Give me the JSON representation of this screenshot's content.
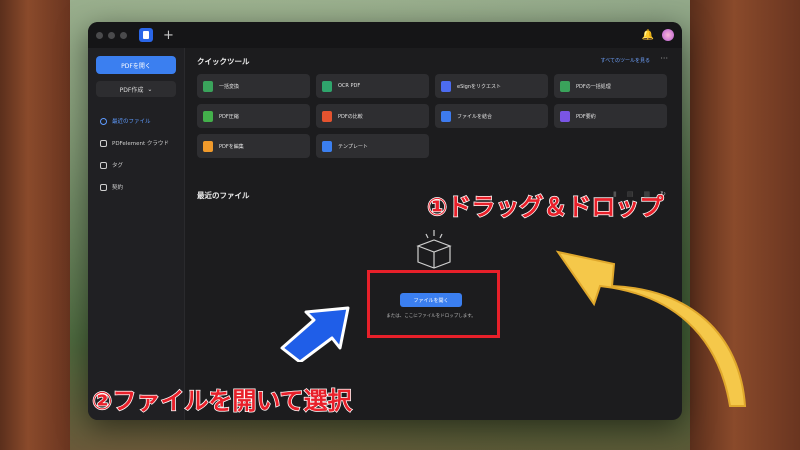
{
  "window": {
    "tab_plus": "+",
    "bell": "🔔"
  },
  "sidebar": {
    "open_pdf": "PDFを開く",
    "create_pdf": "PDF作成",
    "items": [
      {
        "label": "最近のファイル",
        "icon": "clock-icon",
        "active": true
      },
      {
        "label": "PDFelement クラウド",
        "icon": "cloud-icon",
        "active": false
      },
      {
        "label": "タグ",
        "icon": "tag-icon",
        "active": false
      },
      {
        "label": "契約",
        "icon": "contract-icon",
        "active": false
      }
    ]
  },
  "quick_tools": {
    "title": "クイックツール",
    "see_all": "すべてのツールを見る",
    "more": "···",
    "tools": [
      {
        "label": "一括変換",
        "color": "#3aa35b"
      },
      {
        "label": "OCR PDF",
        "color": "#2fa56c"
      },
      {
        "label": "eSignをリクエスト",
        "color": "#4c6cf0"
      },
      {
        "label": "PDFの一括処理",
        "color": "#3aa35b"
      },
      {
        "label": "PDF圧縮",
        "color": "#43b04b"
      },
      {
        "label": "PDFの比較",
        "color": "#e5532f"
      },
      {
        "label": "ファイルを結合",
        "color": "#3d7bef"
      },
      {
        "label": "PDF要約",
        "color": "#7a55e5"
      },
      {
        "label": "PDFを編集",
        "color": "#f09a2b"
      },
      {
        "label": "テンプレート",
        "color": "#3b7ff0"
      }
    ]
  },
  "recent": {
    "title": "最近のファイル",
    "open_file": "ファイルを開く",
    "drop_text": "または、ここにファイルをドロップします。"
  },
  "annotations": {
    "step1": "①ドラッグ＆ドロップ",
    "step2": "②ファイルを開いて選択",
    "accent_red": "#e8202a",
    "arrow_yellow": "#f5c84a",
    "arrow_blue": "#1f5ee8"
  }
}
